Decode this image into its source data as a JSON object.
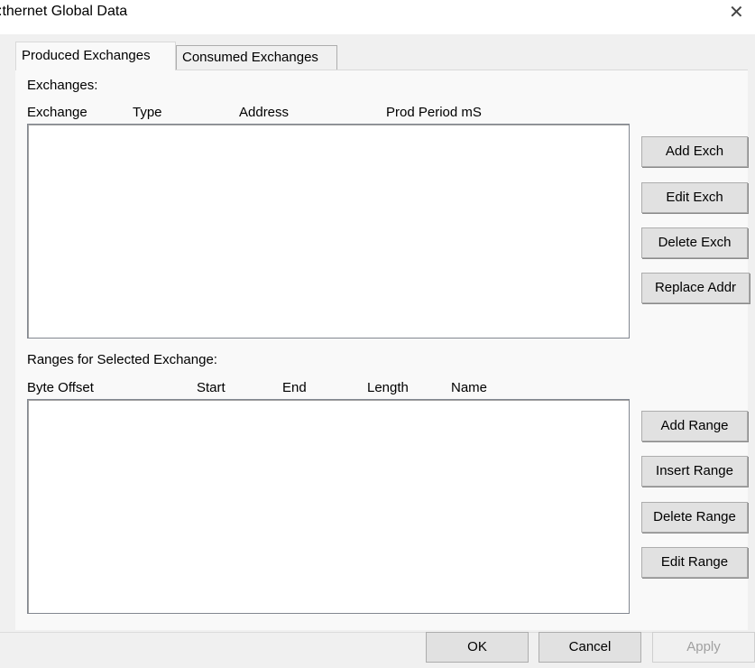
{
  "window": {
    "title": ":thernet Global Data",
    "close_icon": "close-icon"
  },
  "tabs": [
    {
      "label": "Produced Exchanges",
      "active": true
    },
    {
      "label": "Consumed Exchanges",
      "active": false
    }
  ],
  "exchanges": {
    "section_label": "Exchanges:",
    "columns": [
      "Exchange",
      "Type",
      "Address",
      "Prod Period mS"
    ],
    "rows": [],
    "buttons": {
      "add": "Add Exch",
      "edit": "Edit Exch",
      "delete": "Delete Exch",
      "replace": "Replace Addr"
    }
  },
  "ranges": {
    "section_label": "Ranges for Selected Exchange:",
    "columns": [
      "Byte Offset",
      "Start",
      "End",
      "Length",
      "Name"
    ],
    "rows": [],
    "buttons": {
      "add": "Add Range",
      "insert": "Insert Range",
      "delete": "Delete Range",
      "edit": "Edit Range"
    }
  },
  "dialog_buttons": {
    "ok": "OK",
    "cancel": "Cancel",
    "apply": "Apply"
  }
}
